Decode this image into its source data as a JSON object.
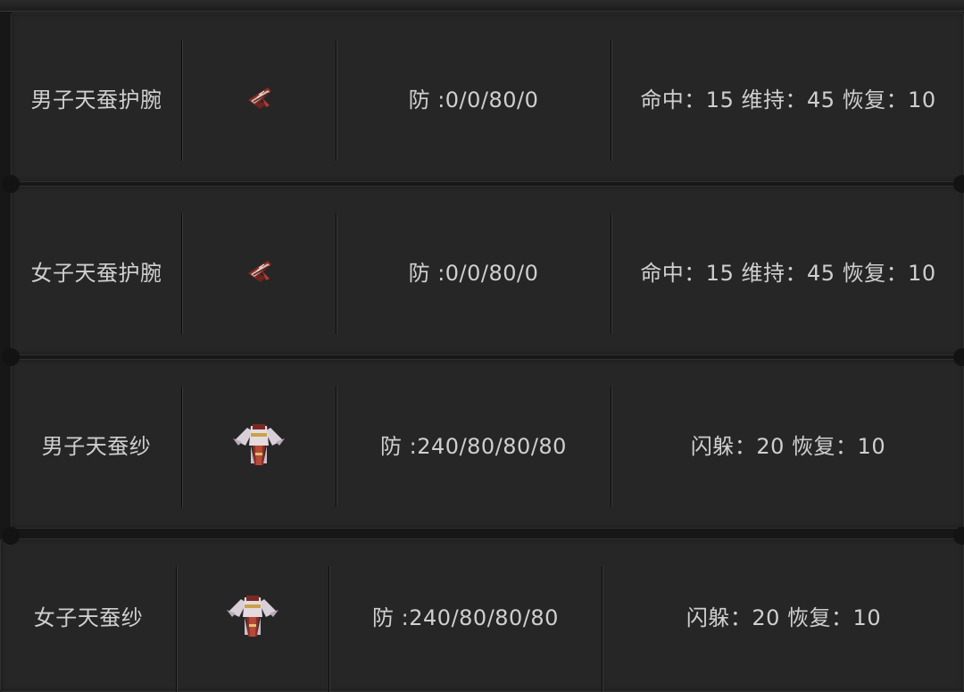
{
  "table": {
    "rows": [
      {
        "name": "男子天蚕护腕",
        "icon": "bracer-icon",
        "defense": "防 :0/0/80/0",
        "attributes": "命中：15 维持：45 恢复：10"
      },
      {
        "name": "女子天蚕护腕",
        "icon": "bracer-icon",
        "defense": "防 :0/0/80/0",
        "attributes": "命中：15 维持：45 恢复：10"
      },
      {
        "name": "男子天蚕纱",
        "icon": "robe-icon",
        "defense": "防 :240/80/80/80",
        "attributes": "闪躲：20 恢复：10"
      },
      {
        "name": "女子天蚕纱",
        "icon": "robe-icon",
        "defense": "防 :240/80/80/80",
        "attributes": "闪躲：20 恢复：10"
      }
    ]
  },
  "colors": {
    "background": "#171717",
    "row_background": "#262626",
    "text": "#cfcfcf"
  }
}
